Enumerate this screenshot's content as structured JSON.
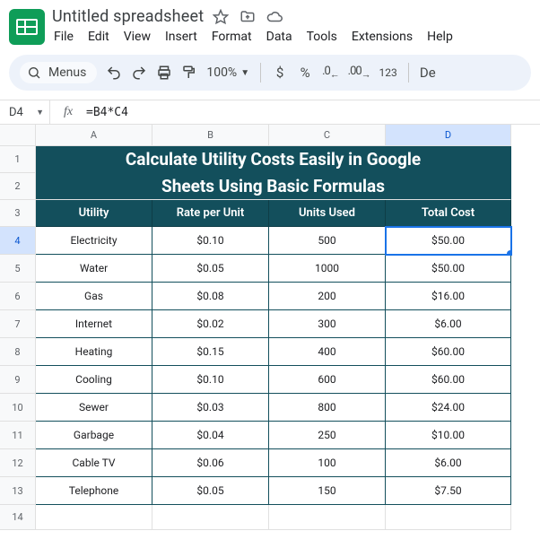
{
  "doc": {
    "title": "Untitled spreadsheet"
  },
  "menubar": [
    "File",
    "Edit",
    "View",
    "Insert",
    "Format",
    "Data",
    "Tools",
    "Extensions",
    "Help"
  ],
  "toolbar": {
    "menus_label": "Menus",
    "zoom": "100%",
    "currency": "$",
    "percent": "%",
    "dec_dec": ".0",
    "dec_inc": ".00",
    "num123": "123",
    "font_prefix": "De"
  },
  "namebox": "D4",
  "formula": "=B4*C4",
  "columns": [
    "A",
    "B",
    "C",
    "D"
  ],
  "banner": {
    "line1": "Calculate Utility Costs Easily in Google",
    "line2": "Sheets Using Basic Formulas"
  },
  "headers": [
    "Utility",
    "Rate per Unit",
    "Units Used",
    "Total Cost"
  ],
  "rows": [
    {
      "n": "4",
      "utility": "Electricity",
      "rate": "$0.10",
      "units": "500",
      "total": "$50.00"
    },
    {
      "n": "5",
      "utility": "Water",
      "rate": "$0.05",
      "units": "1000",
      "total": "$50.00"
    },
    {
      "n": "6",
      "utility": "Gas",
      "rate": "$0.08",
      "units": "200",
      "total": "$16.00"
    },
    {
      "n": "7",
      "utility": "Internet",
      "rate": "$0.02",
      "units": "300",
      "total": "$6.00"
    },
    {
      "n": "8",
      "utility": "Heating",
      "rate": "$0.15",
      "units": "400",
      "total": "$60.00"
    },
    {
      "n": "9",
      "utility": "Cooling",
      "rate": "$0.10",
      "units": "600",
      "total": "$60.00"
    },
    {
      "n": "10",
      "utility": "Sewer",
      "rate": "$0.03",
      "units": "800",
      "total": "$24.00"
    },
    {
      "n": "11",
      "utility": "Garbage",
      "rate": "$0.04",
      "units": "250",
      "total": "$10.00"
    },
    {
      "n": "12",
      "utility": "Cable TV",
      "rate": "$0.06",
      "units": "100",
      "total": "$6.00"
    },
    {
      "n": "13",
      "utility": "Telephone",
      "rate": "$0.05",
      "units": "150",
      "total": "$7.50"
    }
  ],
  "rowlabels": {
    "r1": "1",
    "r2": "2",
    "r3": "3",
    "r14": "14"
  }
}
